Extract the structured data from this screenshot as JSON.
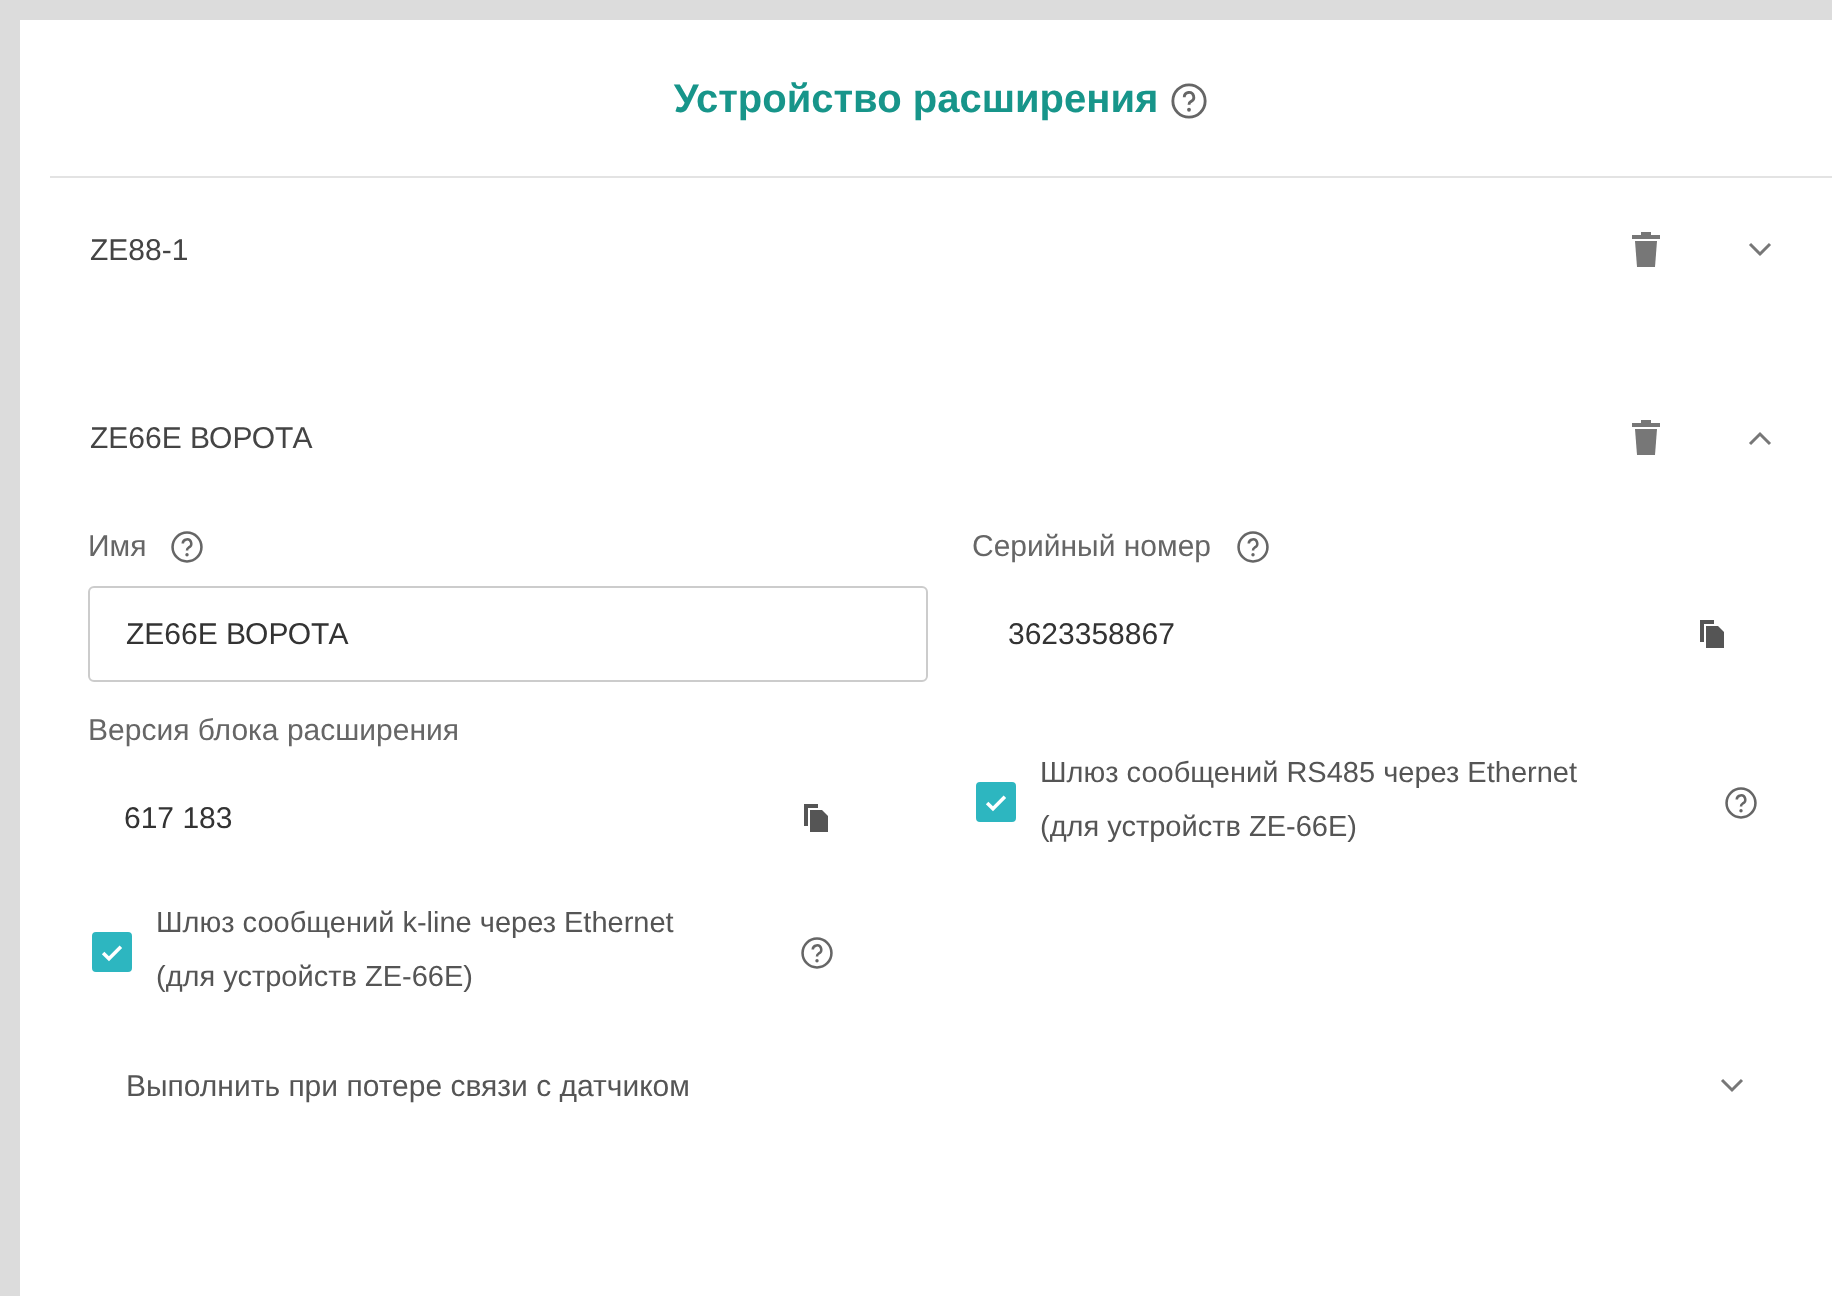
{
  "title": {
    "text": "Устройство расширения"
  },
  "devices": [
    {
      "name": "ZE88-1",
      "expanded": false
    },
    {
      "name": "ZE66E ВОРОТА",
      "expanded": true,
      "form": {
        "name_label": "Имя",
        "name_value": "ZE66E ВОРОТА",
        "serial_label": "Серийный номер",
        "serial_value": "3623358867",
        "version_label": "Версия блока расширения",
        "version_value": "617 183",
        "options": [
          {
            "label": "Шлюз сообщений RS485 через Ethernet (для устройств ZE-66E)",
            "checked": true
          },
          {
            "label": "Шлюз сообщений k-line через Ethernet (для устройств ZE-66E)",
            "checked": true
          }
        ],
        "section": {
          "label": "Выполнить при потере связи с датчиком",
          "expanded": false
        }
      }
    }
  ]
}
